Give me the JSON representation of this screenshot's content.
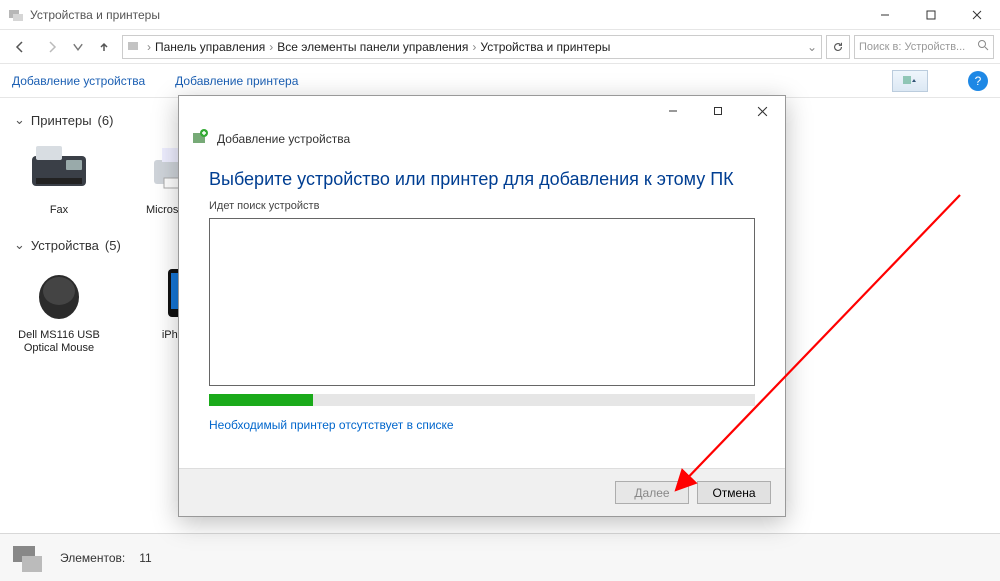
{
  "window": {
    "title": "Устройства и принтеры"
  },
  "breadcrumb": {
    "root": "Панель управления",
    "mid": "Все элементы панели управления",
    "leaf": "Устройства и принтеры"
  },
  "search": {
    "placeholder": "Поиск в: Устройств..."
  },
  "commands": {
    "add_device": "Добавление устройства",
    "add_printer": "Добавление принтера"
  },
  "groups": {
    "printers": {
      "label": "Принтеры",
      "count": "(6)"
    },
    "devices": {
      "label": "Устройства",
      "count": "(5)"
    }
  },
  "printers": [
    {
      "label": "Fax"
    },
    {
      "label": "Microsoft P…"
    }
  ],
  "devices": [
    {
      "label": "Dell MS116 USB Optical Mouse"
    },
    {
      "label": "iPhone"
    }
  ],
  "statusbar": {
    "label": "Элементов:",
    "count": "11"
  },
  "dialog": {
    "header": "Добавление устройства",
    "title": "Выберите устройство или принтер для добавления к этому ПК",
    "subtitle": "Идет поиск устройств",
    "progress_percent": 19,
    "link": "Необходимый принтер отсутствует в списке",
    "next": "Далее",
    "cancel": "Отмена"
  }
}
